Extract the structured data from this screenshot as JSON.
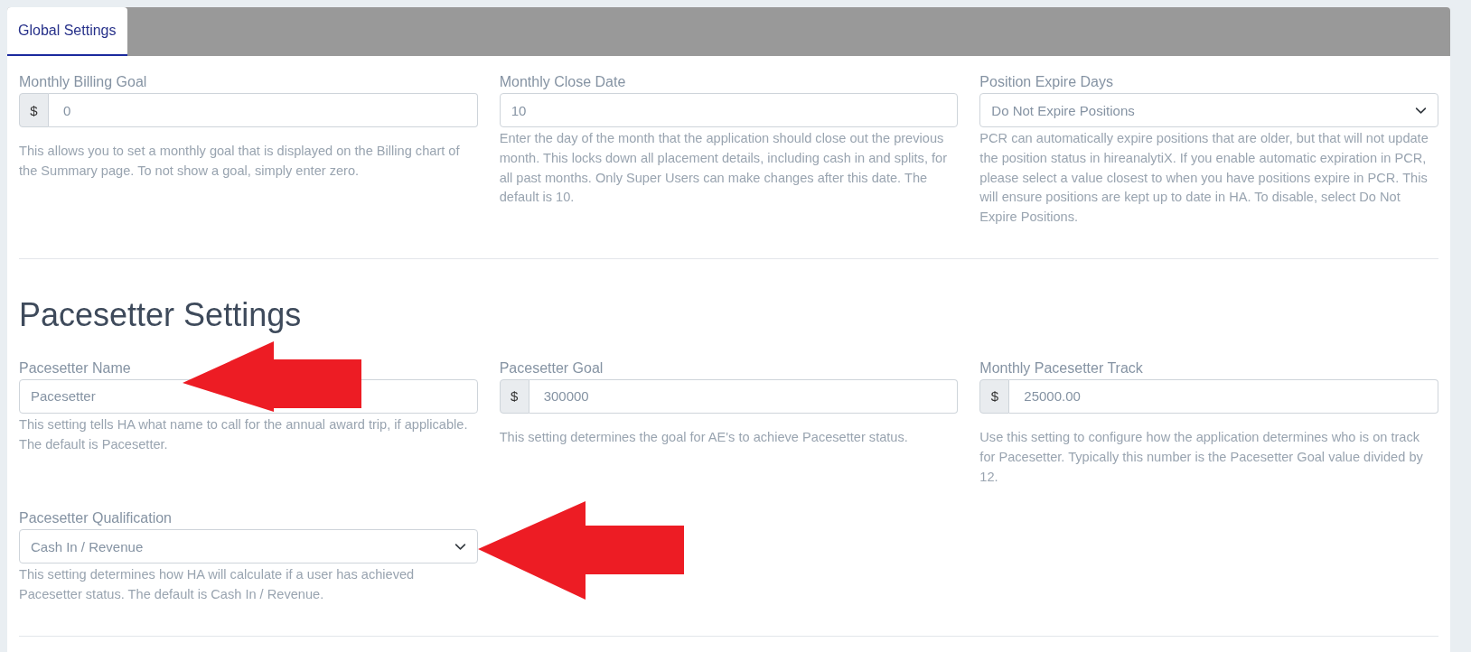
{
  "tabs": [
    {
      "label": "Global Settings",
      "selected": true
    }
  ],
  "general_settings": {
    "fields": [
      {
        "kind": "prefixed",
        "label": "Monthly Billing Goal",
        "prefix": "$",
        "value": "0",
        "help": "This allows you to set a monthly goal that is displayed on the Billing chart of the Summary page. To not show a goal, simply enter zero."
      },
      {
        "kind": "text",
        "label": "Monthly Close Date",
        "value": "10",
        "help": "Enter the day of the month that the application should close out the previous month. This locks down all placement details, including cash in and splits, for all past months. Only Super Users can make changes after this date. The default is 10."
      },
      {
        "kind": "select",
        "label": "Position Expire Days",
        "value": "Do Not Expire Positions",
        "help": "PCR can automatically expire positions that are older, but that will not update the position status in hireanalytiX. If you enable automatic expiration in PCR, please select a value closest to when you have positions expire in PCR. This will ensure positions are kept up to date in HA. To disable, select Do Not Expire Positions."
      }
    ]
  },
  "pacesetter_settings": {
    "heading": "Pacesetter Settings",
    "fields": [
      {
        "kind": "text",
        "label": "Pacesetter Name",
        "value": "Pacesetter",
        "help": "This setting tells HA what name to call for the annual award trip, if applicable. The default is Pacesetter."
      },
      {
        "kind": "prefixed",
        "label": "Pacesetter Goal",
        "prefix": "$",
        "value": "300000",
        "help": "This setting determines the goal for AE's to achieve Pacesetter status."
      },
      {
        "kind": "prefixed",
        "label": "Monthly Pacesetter Track",
        "prefix": "$",
        "value": "25000.00",
        "help": "Use this setting to configure how the application determines who is on track for Pacesetter. Typically this number is the Pacesetter Goal value divided by 12."
      },
      {
        "kind": "select",
        "label": "Pacesetter Qualification",
        "value": "Cash In / Revenue",
        "help": "This setting determines how HA will calculate if a user has achieved Pacesetter status. The default is Cash In / Revenue."
      }
    ]
  }
}
